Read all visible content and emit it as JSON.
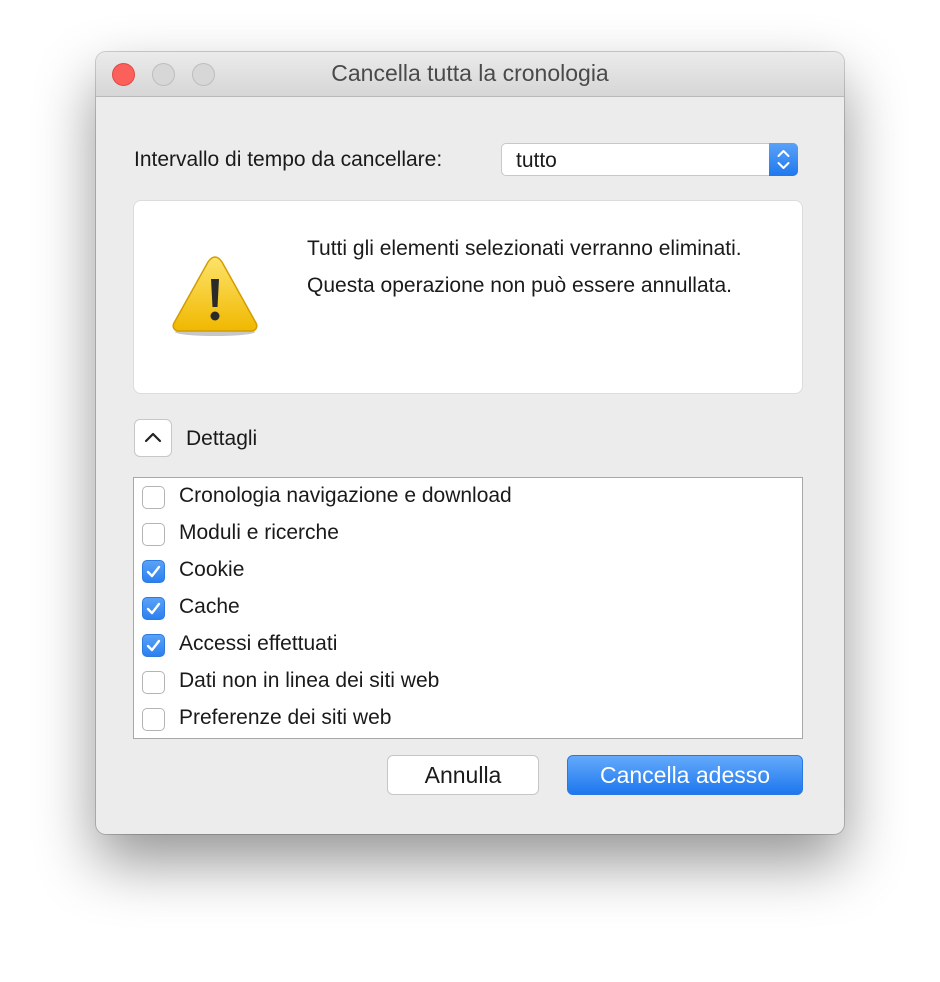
{
  "window": {
    "title": "Cancella tutta la cronologia"
  },
  "time_range": {
    "label": "Intervallo di tempo da cancellare:",
    "selected": "tutto"
  },
  "warning": {
    "icon": "warning-triangle-icon",
    "line1": "Tutti gli elementi selezionati verranno eliminati.",
    "line2": "Questa operazione non può essere annullata."
  },
  "details": {
    "label": "Dettagli",
    "expanded": true
  },
  "items": [
    {
      "label": "Cronologia navigazione e download",
      "checked": false
    },
    {
      "label": "Moduli e ricerche",
      "checked": false
    },
    {
      "label": "Cookie",
      "checked": true
    },
    {
      "label": "Cache",
      "checked": true
    },
    {
      "label": "Accessi effettuati",
      "checked": true
    },
    {
      "label": "Dati non in linea dei siti web",
      "checked": false
    },
    {
      "label": "Preferenze dei siti web",
      "checked": false
    }
  ],
  "buttons": {
    "cancel": "Annulla",
    "confirm": "Cancella adesso"
  },
  "colors": {
    "accent": "#2b80f0",
    "close": "#fc605b"
  }
}
